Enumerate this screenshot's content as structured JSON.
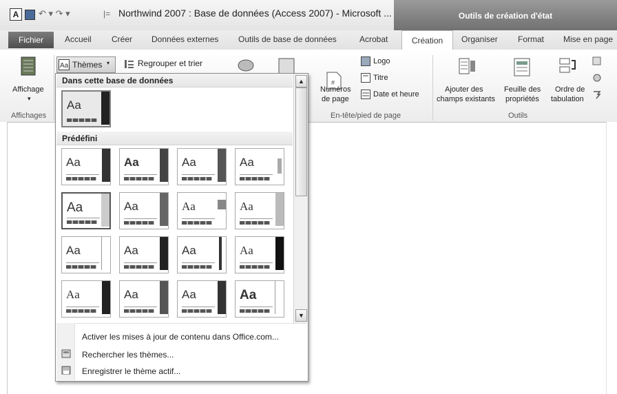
{
  "window": {
    "title": "Northwind 2007 : Base de données (Access 2007)  -  Microsoft ...",
    "contextual_tab_group": "Outils de création d'état",
    "app_icon_letter": "A"
  },
  "tabs": [
    {
      "label": "Fichier"
    },
    {
      "label": "Accueil"
    },
    {
      "label": "Créer"
    },
    {
      "label": "Données externes"
    },
    {
      "label": "Outils de base de données"
    },
    {
      "label": "Acrobat"
    },
    {
      "label": "Création"
    },
    {
      "label": "Organiser"
    },
    {
      "label": "Format"
    },
    {
      "label": "Mise en page"
    }
  ],
  "ribbon": {
    "affichage_label": "Affichage",
    "affichages_group": "Affichages",
    "themes_label": "Thèmes",
    "regroup_label": "Regrouper et trier",
    "numeros_label1": "Numéros",
    "numeros_label2": "de page",
    "logo_label": "Logo",
    "titre_label": "Titre",
    "date_label": "Date et heure",
    "header_group": "En-tête/pied de page",
    "add_fields_1": "Ajouter des",
    "add_fields_2": "champs existants",
    "prop_sheet_1": "Feuille des",
    "prop_sheet_2": "propriétés",
    "tab_order_1": "Ordre de",
    "tab_order_2": "tabulation",
    "outils_group": "Outils"
  },
  "dropdown": {
    "section_db": "Dans cette base de données",
    "section_builtin": "Prédéfini",
    "thumb_text": "Aa",
    "menu": [
      {
        "label": "Activer les mises à jour de contenu dans Office.com...",
        "icon": "none"
      },
      {
        "label": "Rechercher les thèmes...",
        "icon": "browse-icon"
      },
      {
        "label": "Enregistrer le thème actif...",
        "icon": "save-theme-icon"
      }
    ]
  },
  "colors": {
    "contextual": "#7f7f7f",
    "file_tab": "#5a5a5a"
  }
}
